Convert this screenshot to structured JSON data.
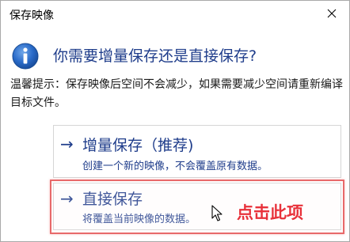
{
  "window": {
    "title": "保存映像",
    "close_icon": "close-icon"
  },
  "dialog": {
    "icon": "info-icon",
    "heading": "你需要增量保存还是直接保存?",
    "description": "温馨提示：保存映像后空间不会减少，如果需要减少空间请重新编译目标文件。"
  },
  "options": [
    {
      "arrow": "→",
      "title": "增量保存（推荐)",
      "subtitle": "创建一个新的映像，不会覆盖原有数据。"
    },
    {
      "arrow": "→",
      "title": "直接保存",
      "subtitle": "将覆盖当前映像的数据。"
    }
  ],
  "annotation": {
    "text": "点击此项"
  },
  "colors": {
    "accent": "#1f3d8b",
    "highlight": "#e8696a",
    "annotation": "#e8313a"
  }
}
